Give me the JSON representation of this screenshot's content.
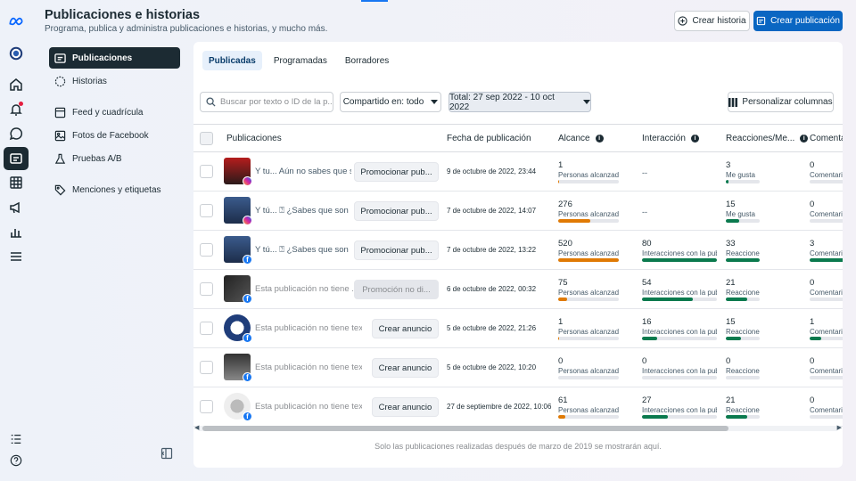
{
  "header": {
    "title": "Publicaciones e historias",
    "subtitle": "Programa, publica y administra publicaciones e historias, y mucho más.",
    "create_story": "Crear historia",
    "create_post": "Crear publicación"
  },
  "nav": [
    {
      "label": "Publicaciones",
      "icon": "posts-icon"
    },
    {
      "label": "Historias",
      "icon": "stories-icon"
    },
    {
      "label": "Feed y cuadrícula",
      "icon": "feed-icon"
    },
    {
      "label": "Fotos de Facebook",
      "icon": "photos-icon"
    },
    {
      "label": "Pruebas A/B",
      "icon": "flask-icon"
    },
    {
      "label": "Menciones y etiquetas",
      "icon": "tag-icon"
    }
  ],
  "tabs": [
    "Publicadas",
    "Programadas",
    "Borradores"
  ],
  "filters": {
    "search_placeholder": "Buscar por texto o ID de la p...",
    "shared_in": "Compartido en: todo",
    "date_range": "Total: 27 sep 2022 - 10 oct 2022",
    "customize": "Personalizar columnas"
  },
  "columns": [
    "Publicaciones",
    "Fecha de publicación",
    "Alcance",
    "Interacción",
    "Reacciones/Me...",
    "Comentar"
  ],
  "rows": [
    {
      "text": "Y tu... Aún no sabes que s...",
      "button": "Promocionar pub...",
      "date": "9 de octubre de 2022, 23:44",
      "reach": "1",
      "reach_label": "Personas alcanzadas",
      "reach_pct": 0.02,
      "inter": "--",
      "inter_label": "",
      "inter_pct": 0,
      "reac": "3",
      "reac_label": "Me gusta",
      "reac_pct": 0.08,
      "com": "0",
      "com_label": "Comentarios",
      "com_pct": 0
    },
    {
      "text": "Y tú... ⍰ ¿Sabes que son l...",
      "button": "Promocionar pub...",
      "date": "7 de octubre de 2022, 14:07",
      "reach": "276",
      "reach_label": "Personas alcanzadas",
      "reach_pct": 0.53,
      "inter": "--",
      "inter_label": "",
      "inter_pct": 0,
      "reac": "15",
      "reac_label": "Me gusta",
      "reac_pct": 0.4,
      "com": "0",
      "com_label": "Comentarios",
      "com_pct": 0
    },
    {
      "text": "Y tú... ⍰ ¿Sabes que son l...",
      "button": "Promocionar pub...",
      "date": "7 de octubre de 2022, 13:22",
      "reach": "520",
      "reac_label": "Reacciones",
      "reach_label": "Personas alcanzadas",
      "reach_pct": 1.0,
      "inter": "80",
      "inter_label": "Interacciones con la publi",
      "inter_pct": 1.0,
      "reac": "33",
      "reac_pct": 1.0,
      "com": "3",
      "com_label": "Comentario",
      "com_pct": 1.0
    },
    {
      "text": "Esta publicación no tiene ...",
      "button": "Promoción no di...",
      "date": "6 de octubre de 2022, 00:32",
      "reach": "75",
      "reach_label": "Personas alcanzadas",
      "reach_pct": 0.14,
      "inter": "54",
      "inter_label": "Interacciones con la publi",
      "inter_pct": 0.68,
      "reac": "21",
      "reac_label": "Reacciones",
      "reac_pct": 0.64,
      "com": "0",
      "com_label": "Comentario",
      "com_pct": 0
    },
    {
      "text": "Esta publicación no tiene texto",
      "button": "Crear anuncio",
      "date": "5 de octubre de 2022, 21:26",
      "reach": "1",
      "reach_label": "Personas alcanzadas",
      "reach_pct": 0.02,
      "inter": "16",
      "inter_label": "Interacciones con la publi",
      "inter_pct": 0.2,
      "reac": "15",
      "reac_label": "Reacciones",
      "reac_pct": 0.45,
      "com": "1",
      "com_label": "Comentario",
      "com_pct": 0.33
    },
    {
      "text": "Esta publicación no tiene texto",
      "button": "Crear anuncio",
      "date": "5 de octubre de 2022, 10:20",
      "reach": "0",
      "reach_label": "Personas alcanzadas",
      "reach_pct": 0,
      "inter": "0",
      "inter_label": "Interacciones con la publi",
      "inter_pct": 0,
      "reac": "0",
      "reac_label": "Reacciones",
      "reac_pct": 0,
      "com": "0",
      "com_label": "Comentario",
      "com_pct": 0
    },
    {
      "text": "Esta publicación no tiene texto",
      "button": "Crear anuncio",
      "date": "27 de septiembre de 2022, 10:06",
      "reach": "61",
      "reach_label": "Personas alcanzadas",
      "reach_pct": 0.12,
      "inter": "27",
      "inter_label": "Interacciones con la publi",
      "inter_pct": 0.34,
      "reac": "21",
      "reac_label": "Reacciones",
      "reac_pct": 0.64,
      "com": "0",
      "com_label": "Comentario",
      "com_pct": 0
    }
  ],
  "footer_note": "Solo las publicaciones realizadas después de marzo de 2019 se mostrarán aquí.",
  "colors": {
    "accent": "#0a66c2",
    "reach_bar": "#e07a04",
    "inter_bar": "#0b7a4e",
    "nav_active": "#1c2b33"
  }
}
